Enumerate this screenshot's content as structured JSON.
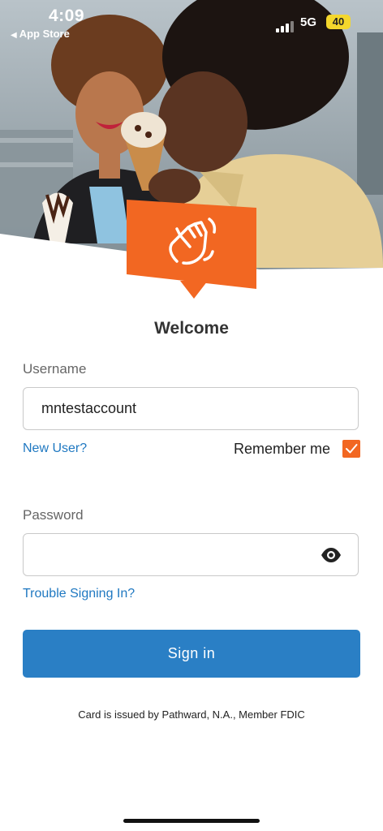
{
  "status_bar": {
    "time": "4:09",
    "back_label": "App Store",
    "network": "5G",
    "battery": "40"
  },
  "hero": {
    "image": "couple-eating-ice-cream-photo",
    "badge_icon": "waving-hand-icon",
    "accent_color": "#f26722"
  },
  "login": {
    "title": "Welcome",
    "username_label": "Username",
    "username_value": "mntestaccount",
    "new_user_link": "New User?",
    "remember_label": "Remember me",
    "remember_checked": true,
    "password_label": "Password",
    "password_value": "",
    "trouble_link": "Trouble Signing In?",
    "signin_label": "Sign in",
    "primary_color": "#2a7fc5"
  },
  "footer": {
    "disclaimer": "Card is issued by Pathward, N.A., Member FDIC"
  }
}
